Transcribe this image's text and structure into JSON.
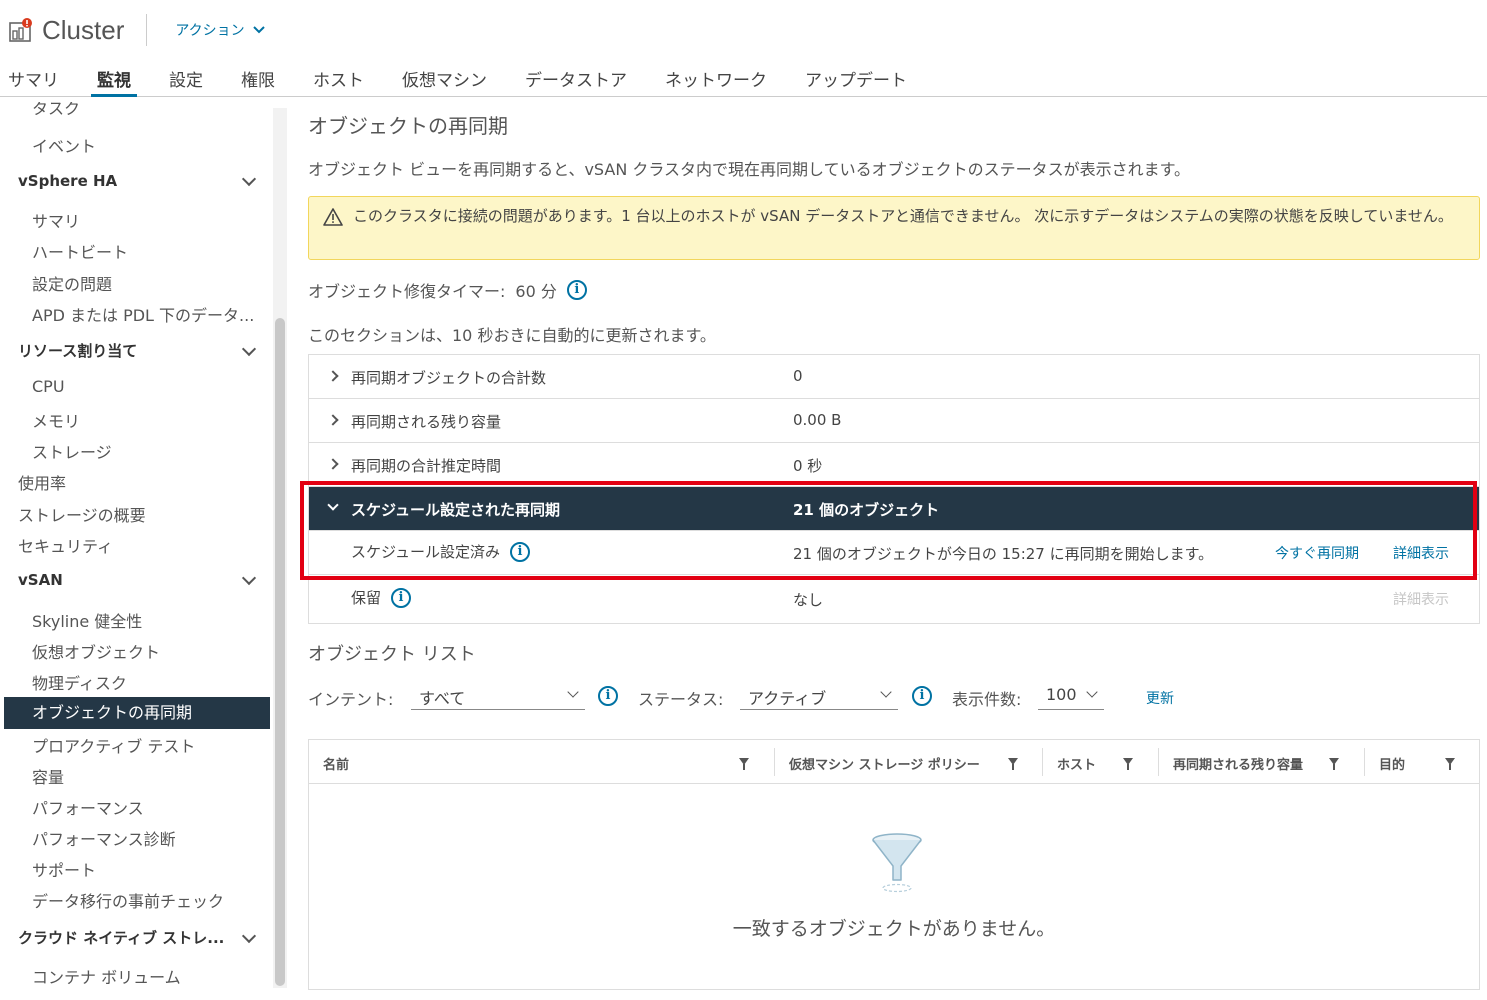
{
  "header": {
    "title": "Cluster",
    "actions_label": "アクション",
    "tabs": [
      "サマリ",
      "監視",
      "設定",
      "権限",
      "ホスト",
      "仮想マシン",
      "データストア",
      "ネットワーク",
      "アップデート"
    ],
    "active_tab": "監視"
  },
  "sidebar": {
    "items": [
      "タスク",
      "イベント"
    ],
    "vsphere_ha": {
      "label": "vSphere HA",
      "items": [
        "サマリ",
        "ハートビート",
        "設定の問題",
        "APD または PDL 下のデータ..."
      ]
    },
    "resource": {
      "label": "リソース割り当て",
      "items": [
        "CPU",
        "メモリ",
        "ストレージ"
      ]
    },
    "misc": [
      "使用率",
      "ストレージの概要",
      "セキュリティ"
    ],
    "vsan": {
      "label": "vSAN",
      "items": [
        "Skyline 健全性",
        "仮想オブジェクト",
        "物理ディスク",
        "オブジェクトの再同期",
        "プロアクティブ テスト",
        "容量",
        "パフォーマンス",
        "パフォーマンス診断",
        "サポート",
        "データ移行の事前チェック"
      ]
    },
    "cloud": {
      "label": "クラウド ネイティブ ストレ...",
      "items": [
        "コンテナ ボリューム"
      ]
    },
    "selected": "オブジェクトの再同期"
  },
  "main": {
    "title": "オブジェクトの再同期",
    "description": "オブジェクト ビューを再同期すると、vSAN クラスタ内で現在再同期しているオブジェクトのステータスが表示されます。",
    "alert": "このクラスタに接続の問題があります。1 台以上のホストが vSAN データストアと通信できません。 次に示すデータはシステムの実際の状態を反映していません。",
    "repair_timer_label": "オブジェクト修復タイマー:",
    "repair_timer_value": "60 分",
    "auto_refresh": "このセクションは、10 秒おきに自動的に更新されます。",
    "rows": [
      {
        "label": "再同期オブジェクトの合計数",
        "value": "0"
      },
      {
        "label": "再同期される残り容量",
        "value": "0.00 B"
      },
      {
        "label": "再同期の合計推定時間",
        "value": "0 秒"
      }
    ],
    "scheduled": {
      "label": "スケジュール設定された再同期",
      "value": "21 個のオブジェクト"
    },
    "scheduled_detail": {
      "label": "スケジュール設定済み",
      "value": "21 個のオブジェクトが今日の 15:27 に再同期を開始します。",
      "resync_now": "今すぐ再同期",
      "details": "詳細表示"
    },
    "pending": {
      "label": "保留",
      "value": "なし",
      "details": "詳細表示"
    },
    "list_title": "オブジェクト リスト",
    "filters": {
      "intent_label": "インテント:",
      "intent_value": "すべて",
      "status_label": "ステータス:",
      "status_value": "アクティブ",
      "count_label": "表示件数:",
      "count_value": "100",
      "refresh": "更新"
    },
    "columns": [
      "名前",
      "仮想マシン ストレージ ポリシー",
      "ホスト",
      "再同期される残り容量",
      "目的"
    ],
    "empty_message": "一致するオブジェクトがありません。"
  },
  "colors": {
    "accent": "#0072a3",
    "selected_bg": "#243746",
    "highlight": "#e20012",
    "alert_bg": "#fdf6c8"
  }
}
